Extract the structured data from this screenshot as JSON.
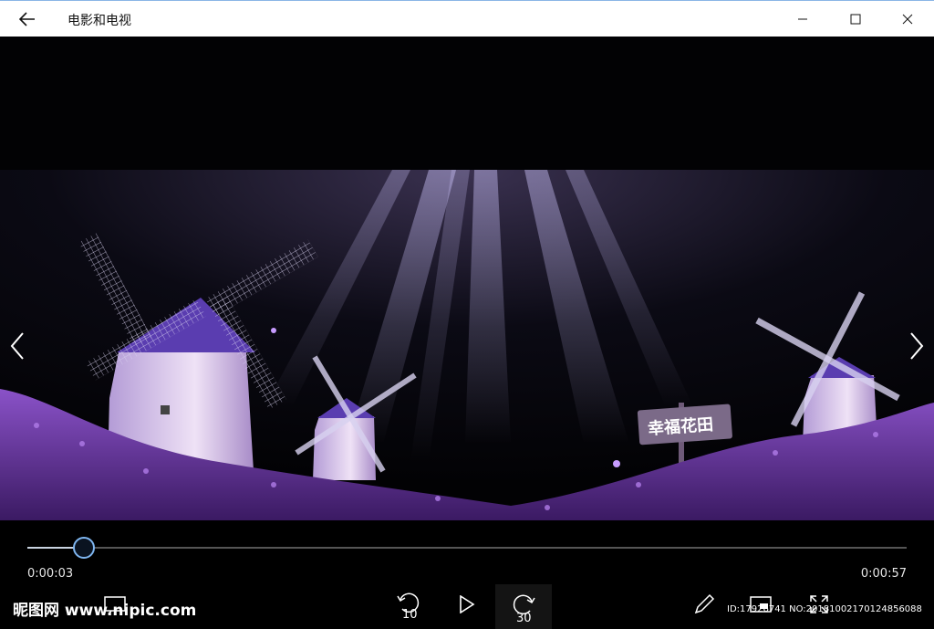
{
  "window": {
    "title": "电影和电视",
    "back_icon": "arrow-left-icon",
    "minimize_icon": "minimize-icon",
    "maximize_icon": "maximize-icon",
    "close_icon": "close-icon"
  },
  "video": {
    "sign_text": "幸福花田",
    "prev_icon": "chevron-left-icon",
    "next_icon": "chevron-right-icon"
  },
  "player": {
    "current_time": "0:00:03",
    "total_time": "0:00:57",
    "progress": 0.064,
    "skip_back_label": "10",
    "skip_forward_label": "30"
  },
  "watermark": {
    "left_text": "昵图网 www.nipic.com",
    "right_text": "ID:17926741 NO:20181002170124856088"
  },
  "colors": {
    "accent": "#7fb6f0",
    "lavender": "#8a52c8"
  }
}
